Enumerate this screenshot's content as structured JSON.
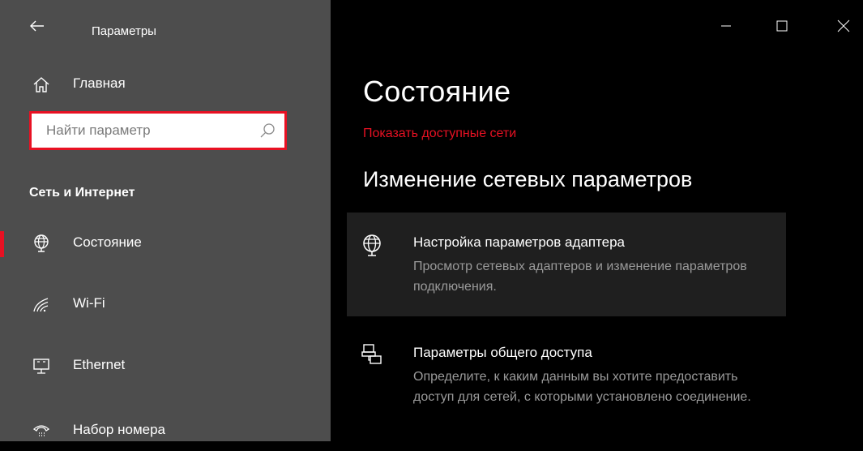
{
  "app": {
    "title": "Параметры"
  },
  "sidebar": {
    "home_label": "Главная",
    "search": {
      "placeholder": "Найти параметр",
      "value": ""
    },
    "section_title": "Сеть и Интернет",
    "items": [
      {
        "label": "Состояние",
        "icon": "globe-icon",
        "selected": true
      },
      {
        "label": "Wi-Fi",
        "icon": "wifi-icon",
        "selected": false
      },
      {
        "label": "Ethernet",
        "icon": "ethernet-icon",
        "selected": false
      },
      {
        "label": "Набор номера",
        "icon": "dialup-icon",
        "selected": false
      }
    ]
  },
  "main": {
    "page_title": "Состояние",
    "show_networks_link": "Показать доступные сети",
    "subsection_title": "Изменение сетевых параметров",
    "cards": [
      {
        "title": "Настройка параметров адаптера",
        "desc": "Просмотр сетевых адаптеров и изменение параметров подключения.",
        "icon": "adapter-icon"
      },
      {
        "title": "Параметры общего доступа",
        "desc": "Определите, к каким данным вы хотите предоставить доступ для сетей, с которыми установлено соединение.",
        "icon": "sharing-icon"
      }
    ]
  },
  "colors": {
    "sidebar_bg": "#4d4d4d",
    "main_bg": "#000000",
    "accent": "#e81123",
    "card_hover": "#1f1f1f"
  }
}
